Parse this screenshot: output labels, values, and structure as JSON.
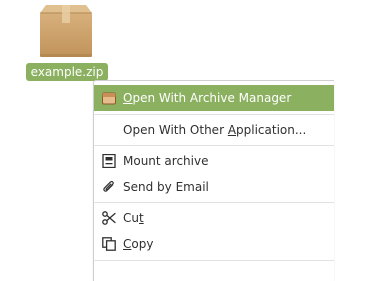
{
  "desktop": {
    "file_icon": "package-archive-icon",
    "file_name": "example.zip"
  },
  "context_menu": {
    "items": [
      {
        "icon": "archive-manager-icon",
        "pre": "",
        "mn": "O",
        "post": "pen With Archive Manager",
        "highlighted": true
      },
      {
        "icon": null,
        "pre": "Open With Other ",
        "mn": "A",
        "post": "pplication...",
        "highlighted": false
      },
      {
        "icon": "mount-archive-icon",
        "pre": "Mount archive",
        "mn": "",
        "post": "",
        "highlighted": false
      },
      {
        "icon": "paperclip-icon",
        "pre": "Send by Email",
        "mn": "",
        "post": "",
        "highlighted": false
      },
      {
        "icon": "scissors-icon",
        "pre": "Cu",
        "mn": "t",
        "post": "",
        "highlighted": false
      },
      {
        "icon": "copy-icon",
        "pre": "",
        "mn": "C",
        "post": "opy",
        "highlighted": false
      }
    ]
  },
  "colors": {
    "selection": "#8bb060",
    "menu_text": "#303030",
    "separator": "#e2e2e2"
  }
}
